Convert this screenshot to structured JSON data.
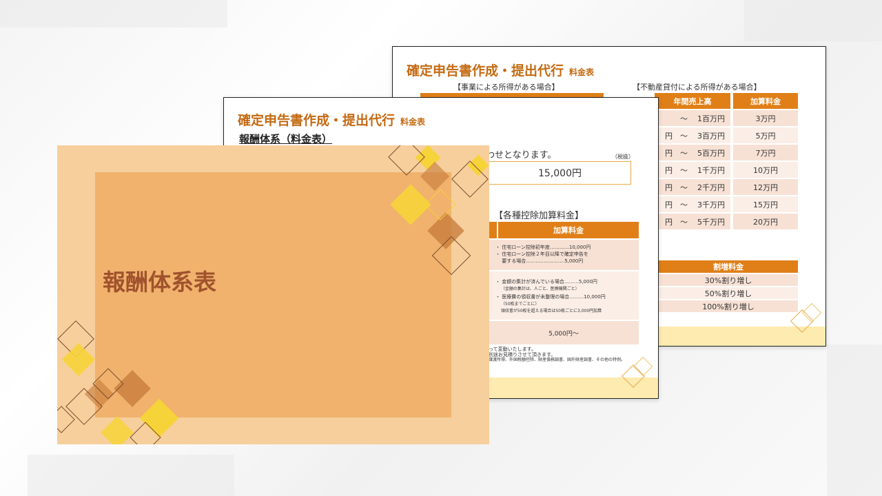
{
  "cover": {
    "title": "報酬体系表"
  },
  "doc_back": {
    "title": "確定申告書作成・提出代行",
    "title_suffix": "料金表",
    "section_business": "【事業による所得がある場合】",
    "section_realestate": "【不動産貸付による所得がある場合】",
    "table_header_sales": "年間売上高",
    "table_header_fee": "加算料金",
    "rows": [
      {
        "prefix": "〜",
        "range": "1百万円",
        "fee": "3万円"
      },
      {
        "prefix": "円　〜",
        "range": "3百万円",
        "fee": "5万円"
      },
      {
        "prefix": "円　〜",
        "range": "5百万円",
        "fee": "7万円"
      },
      {
        "prefix": "円　〜",
        "range": "1千万円",
        "fee": "10万円"
      },
      {
        "prefix": "円　〜",
        "range": "2千万円",
        "fee": "12万円"
      },
      {
        "prefix": "円　〜",
        "range": "3千万円",
        "fee": "15万円"
      },
      {
        "prefix": "円　〜",
        "range": "5千万円",
        "fee": "20万円"
      }
    ],
    "surcharge_header": "割増料金",
    "surcharges": [
      "30%割り増し",
      "50%割り増し",
      "100%割り増し"
    ]
  },
  "doc_mid": {
    "title": "確定申告書作成・提出代行",
    "title_suffix": "料金表",
    "subtitle": "報酬体系（料金表）",
    "base_note": "わせとなります。",
    "tax_note": "（税抜）",
    "base_fee": "15,000円",
    "deduction_title": "【各種控除加算料金】",
    "deduction_header": "加算料金",
    "deduction_lines_1": [
      "・ 住宅ローン控除初年度…………10,000円",
      "・ 住宅ローン控除２年目以降で確定申告を",
      "　 要する場合……………………5,000円"
    ],
    "deduction_lines_2": [
      "・ 金額の集計が済んでいる場合………5,000円",
      "　 （金額の集計は、人ごと、医療機関ごと）",
      "・ 医療費の領収書が未整理の場合………10,000円",
      "　 （50枚までごとに）",
      "　 領収書が50枚を超える場合は50枚ごとに3,000円加算"
    ],
    "deduction_fee_3": "5,000円〜",
    "footnotes": [
      "って変動いたします。",
      "別途お見積りさせて頂きます。",
      "譲渡所得、外国税額控除、財産債務調書、国外財産調書、その他の特例。"
    ]
  }
}
